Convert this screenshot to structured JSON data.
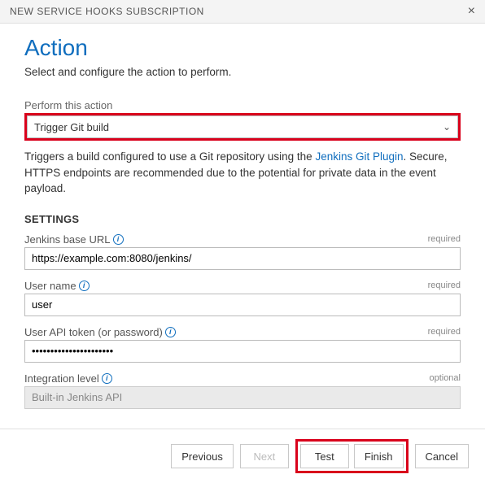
{
  "header": {
    "title": "NEW SERVICE HOOKS SUBSCRIPTION",
    "close": "×"
  },
  "page": {
    "heading": "Action",
    "subtitle": "Select and configure the action to perform."
  },
  "action_select": {
    "label": "Perform this action",
    "value": "Trigger Git build"
  },
  "description": {
    "pre": "Triggers a build configured to use a Git repository using the ",
    "link": "Jenkins Git Plugin",
    "post": ". Secure, HTTPS endpoints are recommended due to the potential for private data in the event payload."
  },
  "settings": {
    "heading": "SETTINGS",
    "required_label": "required",
    "optional_label": "optional",
    "jenkins_url": {
      "label": "Jenkins base URL",
      "value": "https://example.com:8080/jenkins/"
    },
    "user_name": {
      "label": "User name",
      "value": "user"
    },
    "api_token": {
      "label": "User API token (or password)",
      "value": "••••••••••••••••••••••"
    },
    "integration": {
      "label": "Integration level",
      "value": "Built-in Jenkins API"
    }
  },
  "footer": {
    "previous": "Previous",
    "next": "Next",
    "test": "Test",
    "finish": "Finish",
    "cancel": "Cancel"
  }
}
